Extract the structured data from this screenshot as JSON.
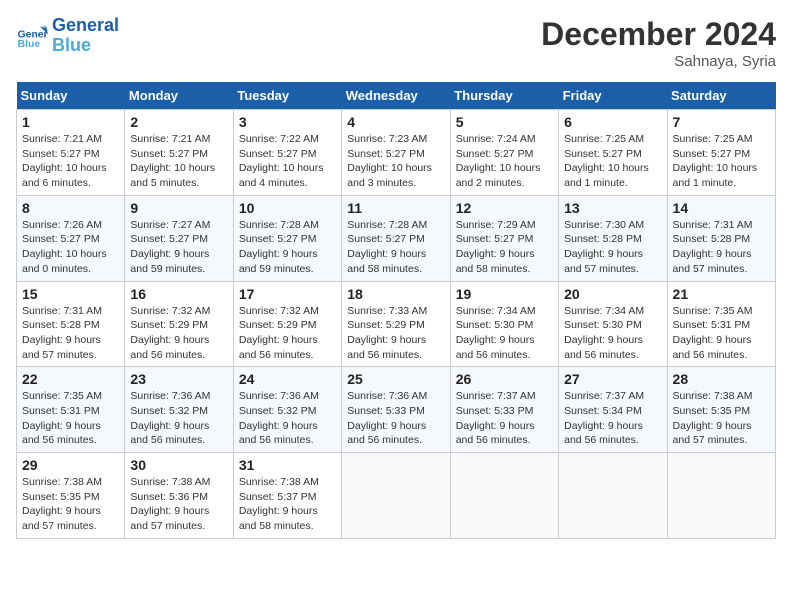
{
  "header": {
    "logo_line1": "General",
    "logo_line2": "Blue",
    "month": "December 2024",
    "location": "Sahnaya, Syria"
  },
  "days_of_week": [
    "Sunday",
    "Monday",
    "Tuesday",
    "Wednesday",
    "Thursday",
    "Friday",
    "Saturday"
  ],
  "weeks": [
    [
      {
        "day": "1",
        "sunrise": "7:21 AM",
        "sunset": "5:27 PM",
        "daylight": "10 hours and 6 minutes."
      },
      {
        "day": "2",
        "sunrise": "7:21 AM",
        "sunset": "5:27 PM",
        "daylight": "10 hours and 5 minutes."
      },
      {
        "day": "3",
        "sunrise": "7:22 AM",
        "sunset": "5:27 PM",
        "daylight": "10 hours and 4 minutes."
      },
      {
        "day": "4",
        "sunrise": "7:23 AM",
        "sunset": "5:27 PM",
        "daylight": "10 hours and 3 minutes."
      },
      {
        "day": "5",
        "sunrise": "7:24 AM",
        "sunset": "5:27 PM",
        "daylight": "10 hours and 2 minutes."
      },
      {
        "day": "6",
        "sunrise": "7:25 AM",
        "sunset": "5:27 PM",
        "daylight": "10 hours and 1 minute."
      },
      {
        "day": "7",
        "sunrise": "7:25 AM",
        "sunset": "5:27 PM",
        "daylight": "10 hours and 1 minute."
      }
    ],
    [
      {
        "day": "8",
        "sunrise": "7:26 AM",
        "sunset": "5:27 PM",
        "daylight": "10 hours and 0 minutes."
      },
      {
        "day": "9",
        "sunrise": "7:27 AM",
        "sunset": "5:27 PM",
        "daylight": "9 hours and 59 minutes."
      },
      {
        "day": "10",
        "sunrise": "7:28 AM",
        "sunset": "5:27 PM",
        "daylight": "9 hours and 59 minutes."
      },
      {
        "day": "11",
        "sunrise": "7:28 AM",
        "sunset": "5:27 PM",
        "daylight": "9 hours and 58 minutes."
      },
      {
        "day": "12",
        "sunrise": "7:29 AM",
        "sunset": "5:27 PM",
        "daylight": "9 hours and 58 minutes."
      },
      {
        "day": "13",
        "sunrise": "7:30 AM",
        "sunset": "5:28 PM",
        "daylight": "9 hours and 57 minutes."
      },
      {
        "day": "14",
        "sunrise": "7:31 AM",
        "sunset": "5:28 PM",
        "daylight": "9 hours and 57 minutes."
      }
    ],
    [
      {
        "day": "15",
        "sunrise": "7:31 AM",
        "sunset": "5:28 PM",
        "daylight": "9 hours and 57 minutes."
      },
      {
        "day": "16",
        "sunrise": "7:32 AM",
        "sunset": "5:29 PM",
        "daylight": "9 hours and 56 minutes."
      },
      {
        "day": "17",
        "sunrise": "7:32 AM",
        "sunset": "5:29 PM",
        "daylight": "9 hours and 56 minutes."
      },
      {
        "day": "18",
        "sunrise": "7:33 AM",
        "sunset": "5:29 PM",
        "daylight": "9 hours and 56 minutes."
      },
      {
        "day": "19",
        "sunrise": "7:34 AM",
        "sunset": "5:30 PM",
        "daylight": "9 hours and 56 minutes."
      },
      {
        "day": "20",
        "sunrise": "7:34 AM",
        "sunset": "5:30 PM",
        "daylight": "9 hours and 56 minutes."
      },
      {
        "day": "21",
        "sunrise": "7:35 AM",
        "sunset": "5:31 PM",
        "daylight": "9 hours and 56 minutes."
      }
    ],
    [
      {
        "day": "22",
        "sunrise": "7:35 AM",
        "sunset": "5:31 PM",
        "daylight": "9 hours and 56 minutes."
      },
      {
        "day": "23",
        "sunrise": "7:36 AM",
        "sunset": "5:32 PM",
        "daylight": "9 hours and 56 minutes."
      },
      {
        "day": "24",
        "sunrise": "7:36 AM",
        "sunset": "5:32 PM",
        "daylight": "9 hours and 56 minutes."
      },
      {
        "day": "25",
        "sunrise": "7:36 AM",
        "sunset": "5:33 PM",
        "daylight": "9 hours and 56 minutes."
      },
      {
        "day": "26",
        "sunrise": "7:37 AM",
        "sunset": "5:33 PM",
        "daylight": "9 hours and 56 minutes."
      },
      {
        "day": "27",
        "sunrise": "7:37 AM",
        "sunset": "5:34 PM",
        "daylight": "9 hours and 56 minutes."
      },
      {
        "day": "28",
        "sunrise": "7:38 AM",
        "sunset": "5:35 PM",
        "daylight": "9 hours and 57 minutes."
      }
    ],
    [
      {
        "day": "29",
        "sunrise": "7:38 AM",
        "sunset": "5:35 PM",
        "daylight": "9 hours and 57 minutes."
      },
      {
        "day": "30",
        "sunrise": "7:38 AM",
        "sunset": "5:36 PM",
        "daylight": "9 hours and 57 minutes."
      },
      {
        "day": "31",
        "sunrise": "7:38 AM",
        "sunset": "5:37 PM",
        "daylight": "9 hours and 58 minutes."
      },
      null,
      null,
      null,
      null
    ]
  ],
  "labels": {
    "sunrise": "Sunrise:",
    "sunset": "Sunset:",
    "daylight": "Daylight:"
  }
}
